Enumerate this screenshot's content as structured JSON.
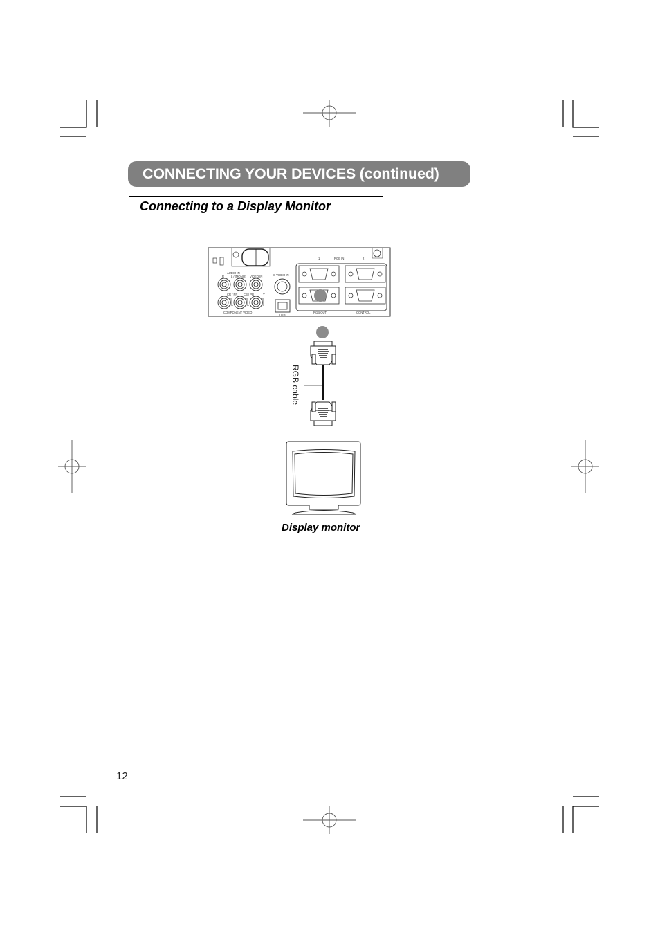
{
  "header": {
    "title": "CONNECTING YOUR DEVICES (continued)",
    "subtitle": "Connecting to a Display Monitor"
  },
  "panel": {
    "audio_in": "AUDIO IN",
    "r": "R",
    "l_mono": "L / (MONO)",
    "video_in": "VIDEO IN",
    "cr_pr": "CR / PR",
    "cb_pb": "CB / PB",
    "y": "Y",
    "component_video": "COMPONENT   VIDEO",
    "s_video_in": "S-VIDEO IN",
    "usb": "USB",
    "rgb_in": "RGB   IN",
    "rgb_in_1": "1",
    "rgb_in_2": "2",
    "rgb_out": "RGB   OUT",
    "control": "CONTROL"
  },
  "cable": {
    "label": "RGB cable"
  },
  "monitor": {
    "caption": "Display monitor"
  },
  "footer": {
    "page_number": "12"
  },
  "colors": {
    "title_bar": "#808080",
    "highlight_port": "#8c8c8c"
  }
}
